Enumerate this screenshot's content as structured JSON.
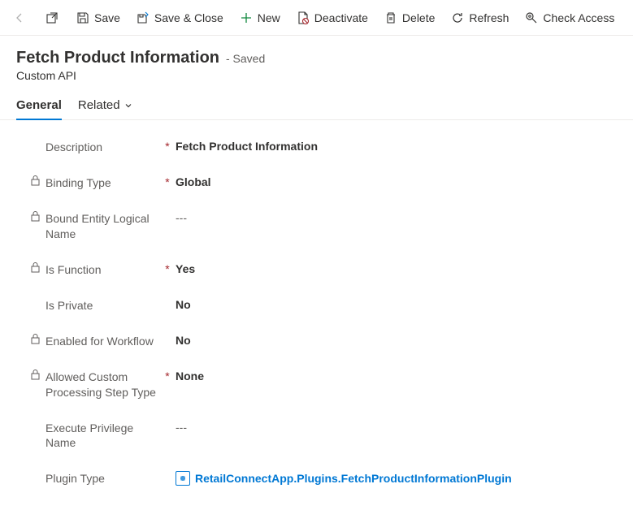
{
  "toolbar": {
    "save": "Save",
    "save_close": "Save & Close",
    "new": "New",
    "deactivate": "Deactivate",
    "delete": "Delete",
    "refresh": "Refresh",
    "check_access": "Check Access"
  },
  "header": {
    "title": "Fetch Product Information",
    "status": "- Saved",
    "entity": "Custom API"
  },
  "tabs": {
    "general": "General",
    "related": "Related"
  },
  "fields": {
    "description": {
      "label": "Description",
      "value": "Fetch Product Information",
      "locked": false,
      "required": true
    },
    "binding_type": {
      "label": "Binding Type",
      "value": "Global",
      "locked": true,
      "required": true
    },
    "bound_entity": {
      "label": "Bound Entity Logical Name",
      "value": "---",
      "locked": true,
      "required": false
    },
    "is_function": {
      "label": "Is Function",
      "value": "Yes",
      "locked": true,
      "required": true
    },
    "is_private": {
      "label": "Is Private",
      "value": "No",
      "locked": false,
      "required": false
    },
    "enabled_workflow": {
      "label": "Enabled for Workflow",
      "value": "No",
      "locked": true,
      "required": false
    },
    "allowed_custom": {
      "label": "Allowed Custom Processing Step Type",
      "value": "None",
      "locked": true,
      "required": true
    },
    "execute_priv": {
      "label": "Execute Privilege Name",
      "value": "---",
      "locked": false,
      "required": false
    },
    "plugin_type": {
      "label": "Plugin Type",
      "value": "RetailConnectApp.Plugins.FetchProductInformationPlugin",
      "locked": false,
      "required": false
    }
  }
}
